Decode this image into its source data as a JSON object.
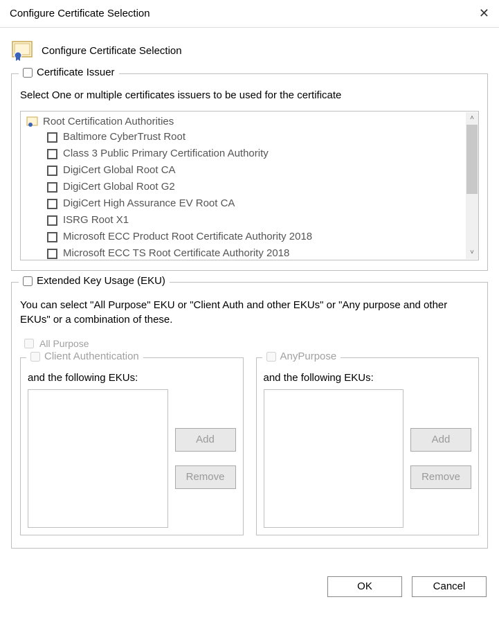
{
  "window": {
    "title": "Configure Certificate Selection",
    "close_glyph": "✕"
  },
  "header": {
    "title": "Configure Certificate Selection"
  },
  "issuer": {
    "legend": "Certificate Issuer",
    "instruction": "Select One or multiple certificates issuers to be used for the certificate",
    "root_label": "Root Certification Authorities",
    "items": [
      "Baltimore CyberTrust Root",
      "Class 3 Public Primary Certification Authority",
      "DigiCert Global Root CA",
      "DigiCert Global Root G2",
      "DigiCert High Assurance EV Root CA",
      "ISRG Root X1",
      "Microsoft ECC Product Root Certificate Authority 2018",
      "Microsoft ECC TS Root Certificate Authority 2018"
    ]
  },
  "eku": {
    "legend": "Extended Key Usage (EKU)",
    "description": "You can select \"All Purpose\" EKU or \"Client Auth and other EKUs\" or \"Any purpose and other EKUs\" or a combination of these.",
    "all_purpose_label": "All Purpose",
    "client": {
      "legend": "Client Authentication",
      "subtitle": "and the following EKUs:",
      "add_label": "Add",
      "remove_label": "Remove"
    },
    "any": {
      "legend": "AnyPurpose",
      "subtitle": "and the following EKUs:",
      "add_label": "Add",
      "remove_label": "Remove"
    }
  },
  "buttons": {
    "ok": "OK",
    "cancel": "Cancel"
  }
}
